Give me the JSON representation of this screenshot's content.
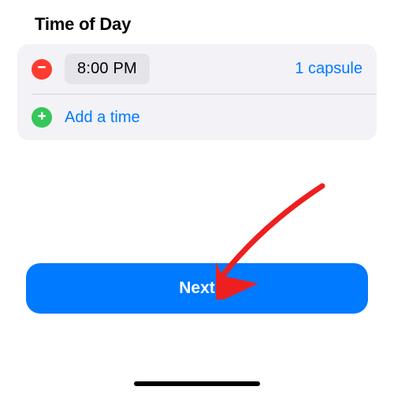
{
  "header": {
    "title": "Time of Day"
  },
  "schedule": {
    "entries": [
      {
        "time": "8:00 PM",
        "dose": "1 capsule"
      }
    ],
    "add_label": "Add a time"
  },
  "actions": {
    "next": "Next"
  },
  "icons": {
    "remove": "remove-circle-icon",
    "add": "add-circle-icon"
  },
  "colors": {
    "accent": "#007aff",
    "danger": "#ff3b30",
    "success": "#34c759",
    "panel": "#f2f2f7"
  }
}
